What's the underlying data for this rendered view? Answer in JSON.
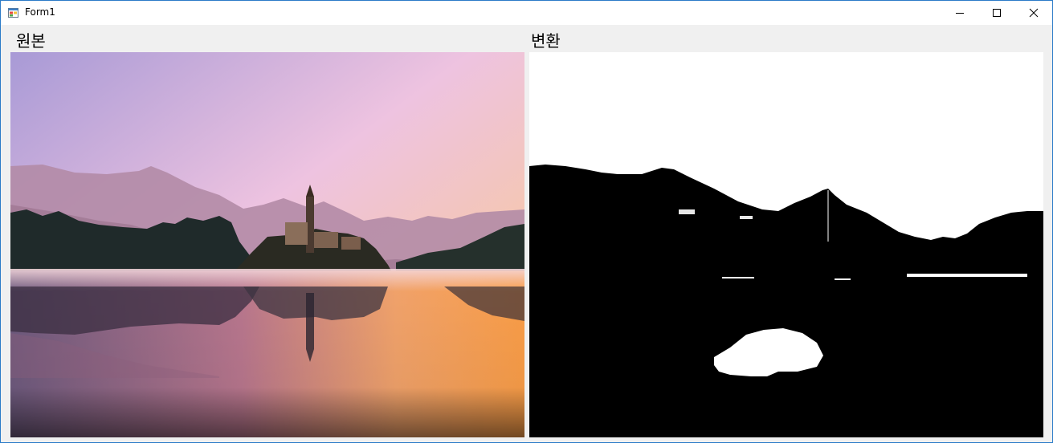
{
  "window": {
    "title": "Form1",
    "icon": "winforms-app-icon",
    "controls": [
      "minimize-icon",
      "maximize-icon",
      "close-icon"
    ]
  },
  "panels": {
    "original": {
      "label": "원본"
    },
    "converted": {
      "label": "변환"
    }
  },
  "colors": {
    "titlebar_bg": "#ffffff",
    "window_border": "#2b7bc8",
    "client_bg": "#f0f0f0"
  }
}
